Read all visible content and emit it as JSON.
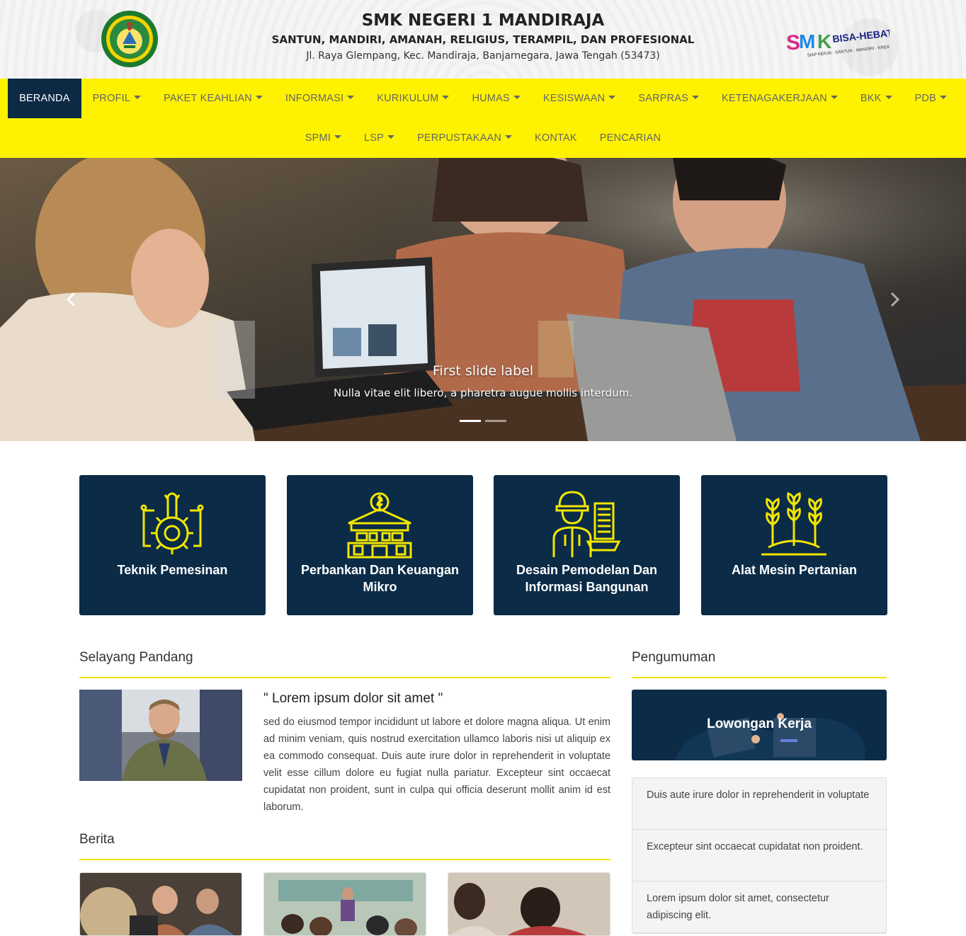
{
  "header": {
    "school_name": "SMK NEGERI 1 MANDIRAJA",
    "motto": "SANTUN, MANDIRI, AMANAH, RELIGIUS, TERAMPIL, DAN PROFESIONAL",
    "address": "Jl. Raya Glempang, Kec. Mandiraja, Banjarnegara, Jawa Tengah (53473)",
    "logo_left_text": "SMK NEGERI 1 MANDIRAJA",
    "logo_right_text": "SMK BISA-HEBAT",
    "logo_right_tagline": "SIAP KERJA · SANTUN · MANDIRI · KREATIF"
  },
  "nav": {
    "row1": [
      {
        "label": "BERANDA",
        "dropdown": false,
        "active": true
      },
      {
        "label": "PROFIL",
        "dropdown": true
      },
      {
        "label": "PAKET KEAHLIAN",
        "dropdown": true
      },
      {
        "label": "INFORMASI",
        "dropdown": true
      },
      {
        "label": "KURIKULUM",
        "dropdown": true
      },
      {
        "label": "HUMAS",
        "dropdown": true
      },
      {
        "label": "KESISWAAN",
        "dropdown": true
      },
      {
        "label": "SARPRAS",
        "dropdown": true
      },
      {
        "label": "KETENAGAKERJAAN",
        "dropdown": true
      },
      {
        "label": "BKK",
        "dropdown": true
      },
      {
        "label": "PDB",
        "dropdown": true
      }
    ],
    "row2": [
      {
        "label": "SPMI",
        "dropdown": true
      },
      {
        "label": "LSP",
        "dropdown": true
      },
      {
        "label": "PERPUSTAKAAN",
        "dropdown": true
      },
      {
        "label": "KONTAK",
        "dropdown": false
      },
      {
        "label": "PENCARIAN",
        "dropdown": false
      }
    ]
  },
  "hero": {
    "caption_title": "First slide label",
    "caption_text": "Nulla vitae elit libero, a pharetra augue mollis interdum.",
    "prev_icon": "chevron-left-icon",
    "next_icon": "chevron-right-icon",
    "slide_count": 2,
    "active_slide": 1
  },
  "programs": [
    {
      "title": "Teknik Pemesinan",
      "icon": "gear-wrench-icon"
    },
    {
      "title": "Perbankan Dan Keuangan Mikro",
      "icon": "bank-icon"
    },
    {
      "title": "Desain Pemodelan Dan Informasi Bangunan",
      "icon": "construction-worker-icon"
    },
    {
      "title": "Alat Mesin Pertanian",
      "icon": "plant-icon"
    }
  ],
  "selayang": {
    "heading": "Selayang Pandang",
    "quote_title": "\" Lorem ipsum dolor sit amet \"",
    "quote_body": "sed do eiusmod tempor incididunt ut labore et dolore magna aliqua. Ut enim ad minim veniam, quis nostrud exercitation ullamco laboris nisi ut aliquip ex ea commodo consequat. Duis aute irure dolor in reprehenderit in voluptate velit esse cillum dolore eu fugiat nulla pariatur. Excepteur sint occaecat cupidatat non proident, sunt in culpa qui officia deserunt mollit anim id est laborum."
  },
  "berita": {
    "heading": "Berita"
  },
  "pengumuman": {
    "heading": "Pengumuman",
    "banner_label": "Lowongan Kerja",
    "items": [
      "Duis aute irure dolor in reprehenderit in voluptate",
      "Excepteur sint occaecat cupidatat non proident.",
      "Lorem ipsum dolor sit amet, consectetur adipiscing elit."
    ]
  },
  "colors": {
    "navbar": "#fff200",
    "nav_active": "#0d2a45",
    "card": "#0b2b47",
    "icon_yellow": "#f2e600",
    "section_line": "#f5e400"
  }
}
